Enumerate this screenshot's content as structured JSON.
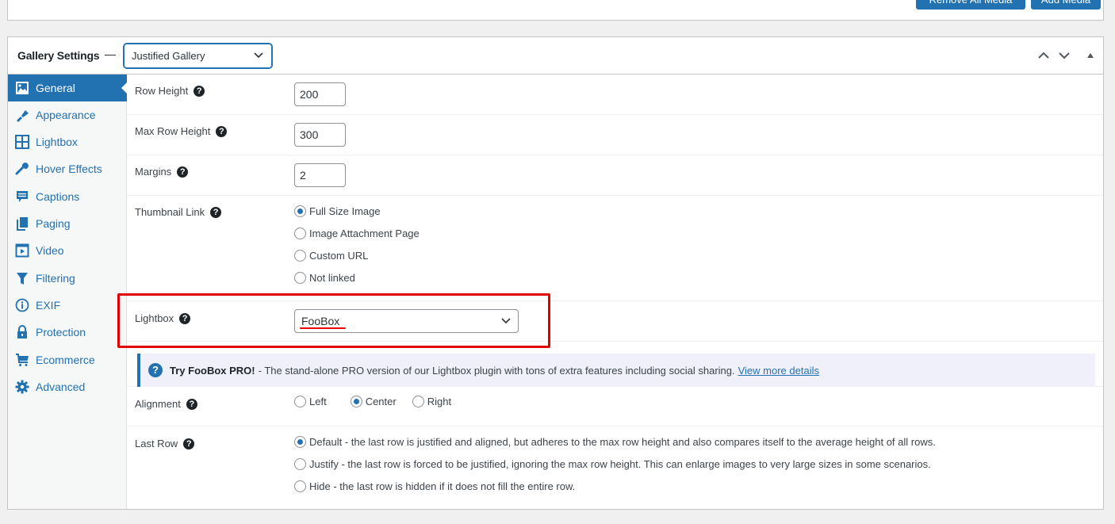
{
  "top_buttons": {
    "remove_all_media": "Remove All Media",
    "add_media": "Add Media"
  },
  "panel": {
    "title": "Gallery Settings",
    "separator": "—",
    "gallery_type": "Justified Gallery",
    "controls": [
      "move-up",
      "move-down",
      "toggle-panel"
    ]
  },
  "sidebar": {
    "items": [
      {
        "label": "General",
        "icon": "image-icon",
        "active": true
      },
      {
        "label": "Appearance",
        "icon": "paintbrush-icon",
        "active": false
      },
      {
        "label": "Lightbox",
        "icon": "grid-icon",
        "active": false
      },
      {
        "label": "Hover Effects",
        "icon": "wrench-icon",
        "active": false
      },
      {
        "label": "Captions",
        "icon": "comment-icon",
        "active": false
      },
      {
        "label": "Paging",
        "icon": "pages-icon",
        "active": false
      },
      {
        "label": "Video",
        "icon": "video-icon",
        "active": false
      },
      {
        "label": "Filtering",
        "icon": "filter-icon",
        "active": false
      },
      {
        "label": "EXIF",
        "icon": "info-icon",
        "active": false
      },
      {
        "label": "Protection",
        "icon": "lock-icon",
        "active": false
      },
      {
        "label": "Ecommerce",
        "icon": "cart-icon",
        "active": false
      },
      {
        "label": "Advanced",
        "icon": "gear-icon",
        "active": false
      }
    ]
  },
  "settings": {
    "row_height": {
      "label": "Row Height",
      "value": "200"
    },
    "max_row_height": {
      "label": "Max Row Height",
      "value": "300"
    },
    "margins": {
      "label": "Margins",
      "value": "2"
    },
    "thumbnail_link": {
      "label": "Thumbnail Link",
      "options": [
        "Full Size Image",
        "Image Attachment Page",
        "Custom URL",
        "Not linked"
      ],
      "selected": "Full Size Image"
    },
    "lightbox": {
      "label": "Lightbox",
      "value": "FooBox"
    },
    "notice": {
      "title": "Try FooBox PRO!",
      "text": "- The stand-alone PRO version of our Lightbox plugin with tons of extra features including social sharing.",
      "link": "View more details"
    },
    "alignment": {
      "label": "Alignment",
      "options": [
        "Left",
        "Center",
        "Right"
      ],
      "selected": "Center"
    },
    "last_row": {
      "label": "Last Row",
      "options": [
        "Default - the last row is justified and aligned, but adheres to the max row height and also compares itself to the average height of all rows.",
        "Justify - the last row is forced to be justified, ignoring the max row height. This can enlarge images to very large sizes in some scenarios.",
        "Hide - the last row is hidden if it does not fill the entire row."
      ],
      "selected": 0
    }
  },
  "colors": {
    "accent": "#2271b1",
    "highlight": "#e00000"
  }
}
